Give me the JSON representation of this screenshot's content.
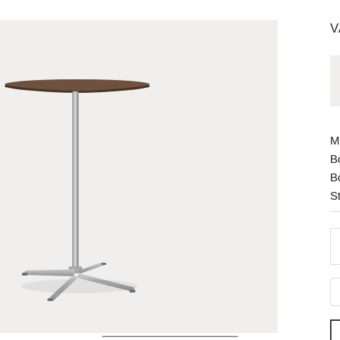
{
  "product": {
    "title": "VA",
    "image_alt": "bar-height-table-product-photo",
    "gallery_background": "#efeeec",
    "tabletop_color": "#6b4e3b",
    "base_color": "#b9bcbe"
  },
  "specs": [
    {
      "label": "M"
    },
    {
      "label": "Bo"
    },
    {
      "label": "Bo"
    },
    {
      "label": "St"
    }
  ],
  "icons": {
    "checkbox": "checkbox-icon"
  }
}
